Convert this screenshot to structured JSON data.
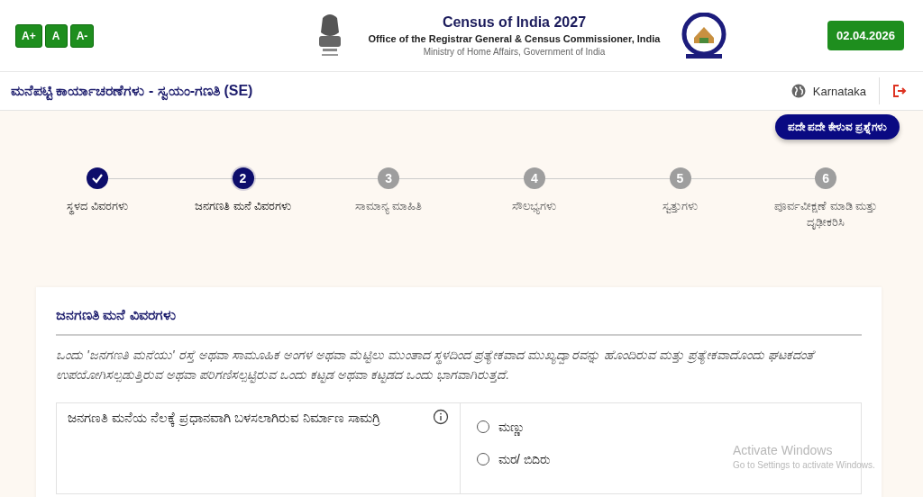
{
  "header": {
    "font_buttons": [
      "A+",
      "A",
      "A-"
    ],
    "title": "Census of India 2027",
    "subtitle": "Office of the Registrar General & Census Commissioner, India",
    "ministry": "Ministry of Home Affairs, Government of India",
    "date": "02.04.2026"
  },
  "page_bar": {
    "title": "ಮನೆಪಟ್ಟಿ ಕಾರ್ಯಾಚರಣೆಗಳು - ಸ್ವಯಂ-ಗಣತಿ (SE)",
    "state": "Karnataka"
  },
  "faq_button": "ಪದೇ ಪದೇ ಕೇಳುವ ಪ್ರಶ್ನೆಗಳು",
  "steps": [
    {
      "label": "ಸ್ಥಳದ ವಿವರಗಳು",
      "completed": true,
      "selected": false
    },
    {
      "number": "2",
      "label": "ಜನಗಣತಿ ಮನೆ ವಿವರಗಳು",
      "completed": false,
      "selected": true
    },
    {
      "number": "3",
      "label": "ಸಾಮಾನ್ಯ ಮಾಹಿತಿ",
      "completed": false,
      "selected": false
    },
    {
      "number": "4",
      "label": "ಸೌಲಭ್ಯಗಳು",
      "completed": false,
      "selected": false
    },
    {
      "number": "5",
      "label": "ಸ್ವತ್ತುಗಳು",
      "completed": false,
      "selected": false
    },
    {
      "number": "6",
      "label": "ಪೂರ್ವವೀಕ್ಷಣೆ ಮಾಡಿ ಮತ್ತು ದೃಢೀಕರಿಸಿ",
      "completed": false,
      "selected": false
    }
  ],
  "section": {
    "title": "ಜನಗಣತಿ ಮನೆ ವಿವರಗಳು",
    "description": "ಒಂದು 'ಜನಗಣತಿ ಮನೆಯು' ರಸ್ತೆ ಅಥವಾ ಸಾಮೂಹಿಕ ಅಂಗಳ ಅಥವಾ ಮೆಟ್ಟಿಲು ಮುಂತಾದ ಸ್ಥಳದಿಂದ ಪ್ರತ್ಯೇಕವಾದ ಮುಖ್ಯದ್ವಾರವನ್ನು ಹೊಂದಿರುವ ಮತ್ತು ಪ್ರತ್ಯೇಕವಾದೊಂದು ಘಟಕದಂತೆ ಉಪಯೋಗಿಸಲ್ಪಡುತ್ತಿರುವ ಅಥವಾ ಪರಿಗಣಿಸಲ್ಪಟ್ಟಿರುವ ಒಂದು ಕಟ್ಟಡ ಅಥವಾ ಕಟ್ಟಡದ ಒಂದು ಭಾಗವಾಗಿರುತ್ತದೆ.",
    "question": {
      "label": "ಜನಗಣತಿ ಮನೆಯ ನೆಲಕ್ಕೆ ಪ್ರಧಾನವಾಗಿ ಬಳಸಲಾಗಿರುವ ನಿರ್ಮಾಣ ಸಾಮಗ್ರಿ",
      "options": [
        {
          "label": "ಮಣ್ಣು",
          "selected": false
        },
        {
          "label": "ಮರ/ ಬಿದಿರು",
          "selected": false
        }
      ]
    }
  },
  "os_overlay": {
    "title": "Activate Windows",
    "hint": "Go to Settings to activate Windows."
  }
}
